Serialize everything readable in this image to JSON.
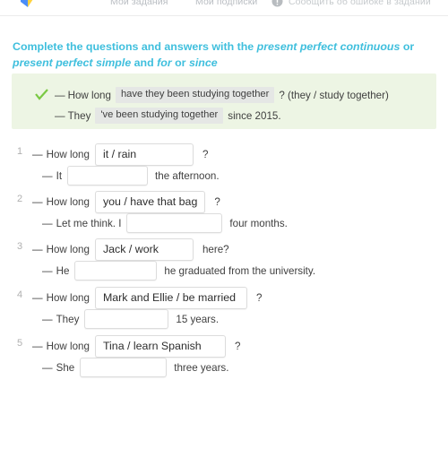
{
  "topnav": {
    "logo_icon": "brainly-arrow-logo",
    "items": [
      {
        "label": "Мои задания",
        "name": "nav-my-tasks"
      },
      {
        "label": "Мои подписки",
        "name": "nav-my-subscriptions"
      }
    ],
    "report": {
      "icon": "warning-circle-icon",
      "label": "Сообщить об ошибке в задании"
    }
  },
  "instruction": {
    "part1": "Complete the questions and answers with the ",
    "em1": "present perfect continuous",
    "part2": " or ",
    "em2": "present perfect simple",
    "part3": " and ",
    "em3": "for",
    "part4": " or ",
    "em4": "since"
  },
  "example": {
    "check_icon": "green-check-icon",
    "line1": {
      "dash": "—",
      "lead": "How long",
      "filled": "have they been studying together",
      "tail": "? (they / study together)"
    },
    "line2": {
      "dash": "—",
      "lead": "They",
      "filled": "'ve been studying together",
      "tail": "since 2015."
    }
  },
  "questions": [
    {
      "number": "1",
      "q_dash": "—",
      "q_lead": "How long",
      "prompt": "it / rain",
      "q_tail": "?",
      "a_dash": "—",
      "a_lead": "It",
      "a_value": "",
      "a_tail": "the afternoon."
    },
    {
      "number": "2",
      "q_dash": "—",
      "q_lead": "How long",
      "prompt": "you / have that bag",
      "q_tail": "?",
      "a_dash": "—",
      "a_lead": "Let me think. I",
      "a_value": "",
      "a_tail": "four months."
    },
    {
      "number": "3",
      "q_dash": "—",
      "q_lead": "How long",
      "prompt": "Jack / work",
      "q_tail": "here?",
      "a_dash": "—",
      "a_lead": "He",
      "a_value": "",
      "a_tail": "he graduated from the university."
    },
    {
      "number": "4",
      "q_dash": "—",
      "q_lead": "How long",
      "prompt": "Mark and Ellie / be married",
      "q_tail": "?",
      "a_dash": "—",
      "a_lead": "They",
      "a_value": "",
      "a_tail": "15 years."
    },
    {
      "number": "5",
      "q_dash": "—",
      "q_lead": "How long",
      "prompt": "Tina / learn Spanish",
      "q_tail": "?",
      "a_dash": "—",
      "a_lead": "She",
      "a_value": "",
      "a_tail": "three years."
    }
  ],
  "colors": {
    "accent_blue": "#3fbfdd",
    "example_bg": "#edf5e4",
    "check_green": "#7ac943",
    "filled_bg": "#e5e7e5",
    "nav_text": "#b9bdc2"
  }
}
